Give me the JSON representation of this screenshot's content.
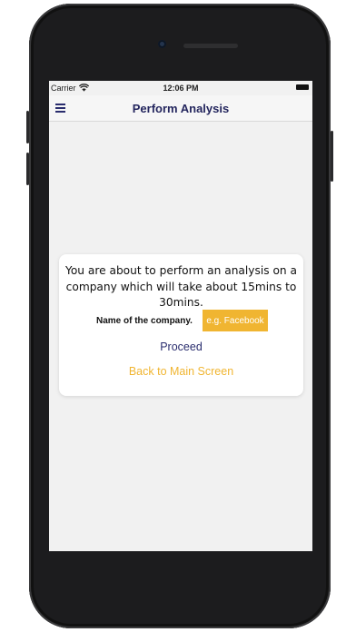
{
  "status_bar": {
    "carrier": "Carrier",
    "time": "12:06 PM"
  },
  "nav": {
    "title": "Perform Analysis",
    "menu_icon": "hamburger-menu-icon"
  },
  "dialog": {
    "message": "You are about to perform an analysis on a company which will take about 15mins to 30mins.",
    "company_label": "Name of the company.",
    "company_placeholder": "e.g. Facebook",
    "company_value": "",
    "proceed_label": "Proceed",
    "back_label": "Back to Main Screen"
  },
  "colors": {
    "primary": "#2a2d6e",
    "accent": "#f0b531",
    "background": "#f1f1f1"
  }
}
